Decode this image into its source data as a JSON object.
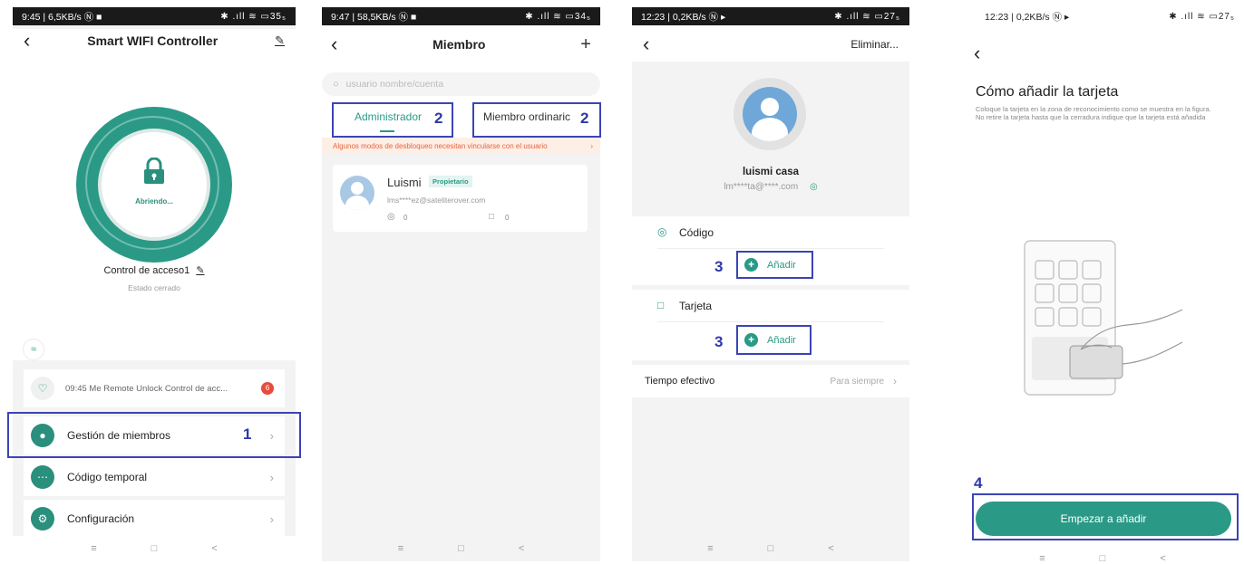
{
  "screen1": {
    "status_left": "9:45 | 6,5KB/s Ⓝ ■",
    "status_right": "✱ .ıll ≋ ▭35₅",
    "title": "Smart WIFI Controller",
    "lock_status": "Abriendo...",
    "device_name": "Control de acceso1",
    "device_state": "Estado cerrado",
    "notification_text": "09:45 Me  Remote Unlock Control de acc...",
    "notification_badge": "6",
    "menu": [
      {
        "label": "Gestión de miembros",
        "icon": "user-icon"
      },
      {
        "label": "Código temporal",
        "icon": "keypad-icon"
      },
      {
        "label": "Configuración",
        "icon": "gear-icon"
      }
    ],
    "step": "1"
  },
  "screen2": {
    "status_left": "9:47 | 58,5KB/s Ⓝ ■",
    "status_right": "✱ .ıll ≋ ▭34₅",
    "title": "Miembro",
    "search_placeholder": "usuario nombre/cuenta",
    "tab_admin": "Administrador",
    "tab_member": "Miembro ordinaric",
    "step": "2",
    "warning": "Algunos modos de desbloqueo necesitan vincularse con el usuario",
    "member_name": "Luismi",
    "member_badge": "Propietario",
    "member_email": "lms****ez@sateliterover.com",
    "count_code": "0",
    "count_card": "0"
  },
  "screen3": {
    "status_left": "12:23 | 0,2KB/s Ⓝ ▸",
    "status_right": "✱ .ıll ≋ ▭27₅",
    "delete_label": "Eliminar...",
    "user_name": "luismi casa",
    "user_email": "lm****ta@****.com",
    "section_code": "Código",
    "section_card": "Tarjeta",
    "add_label": "Añadir",
    "step": "3",
    "effective_label": "Tiempo efectivo",
    "effective_value": "Para siempre"
  },
  "screen4": {
    "status_left": "12:23 | 0,2KB/s Ⓝ ▸",
    "status_right": "✱ .ıll ≋ ▭27₅",
    "title": "Cómo añadir la tarjeta",
    "description": "Coloque la tarjeta en la zona de reconocimiento como se muestra en la figura. No retire la tarjeta hasta que la cerradura indique que la tarjeta está añadida",
    "button_label": "Empezar a añadir",
    "step": "4"
  },
  "nav_glyphs": {
    "menu": "≡",
    "home": "□",
    "back": "<"
  },
  "colors": {
    "accent": "#2a9a87",
    "annotation": "#3b44b6",
    "badge": "#e84b3c",
    "warning": "#e8643c"
  }
}
